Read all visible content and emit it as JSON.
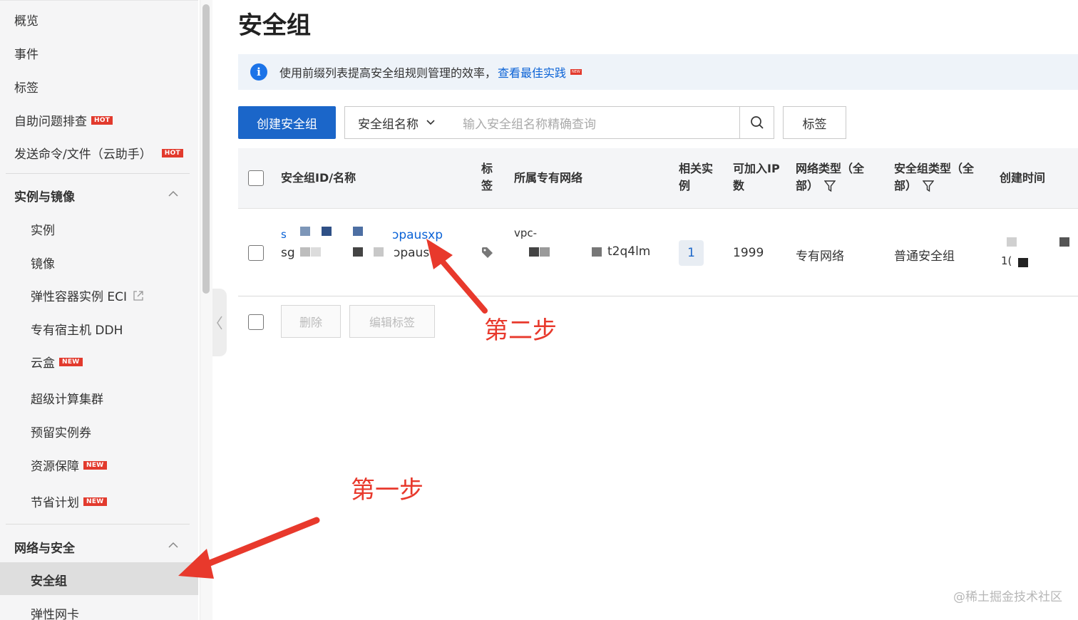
{
  "sidebar": {
    "top_items": [
      {
        "label": "概览"
      },
      {
        "label": "事件"
      },
      {
        "label": "标签"
      },
      {
        "label": "自助问题排查",
        "badge": "HOT"
      },
      {
        "label": "发送命令/文件（云助手）",
        "badge": "HOT"
      }
    ],
    "section_instances": {
      "title": "实例与镜像",
      "items": [
        {
          "label": "实例"
        },
        {
          "label": "镜像"
        },
        {
          "label": "弹性容器实例 ECI"
        },
        {
          "label": "专有宿主机 DDH"
        },
        {
          "label": "云盒",
          "badge": "NEW"
        },
        {
          "label": "超级计算集群"
        },
        {
          "label": "预留实例券"
        },
        {
          "label": "资源保障",
          "badge": "NEW"
        },
        {
          "label": "节省计划",
          "badge": "NEW"
        }
      ]
    },
    "section_network": {
      "title": "网络与安全",
      "items": [
        {
          "label": "安全组",
          "active": true
        },
        {
          "label": "弹性网卡"
        }
      ]
    }
  },
  "main": {
    "title": "安全组",
    "info": {
      "text": "使用前缀列表提高安全组规则管理的效率，",
      "link": "查看最佳实践",
      "link_badge": "NEW"
    },
    "toolbar": {
      "create_label": "创建安全组",
      "filter_field": "安全组名称",
      "search_placeholder": "输入安全组名称精确查询",
      "tag_label": "标签"
    },
    "table": {
      "headers": {
        "id_name": "安全组ID/名称",
        "tag_line1": "标",
        "tag_line2": "签",
        "vpc": "所属专有网络",
        "instances_line1": "相关实",
        "instances_line2": "例",
        "ip_line1": "可加入IP",
        "ip_line2": "数",
        "nettype_line1": "网络类型（全",
        "nettype_line2": "部）",
        "sgtype_line1": "安全组类型（全",
        "sgtype_line2": "部）",
        "created": "创建时间"
      },
      "row": {
        "id_prefix": "s",
        "id_suffix": "ɔpausxp",
        "name_prefix": "sg",
        "name_suffix": "ɔpaus",
        "vpc_line1": "vpc-",
        "vpc_suffix": "t2q4lm",
        "instances": "1",
        "ip_count": "1999",
        "network_type": "专有网络",
        "sg_type": "普通安全组",
        "created_fragment": "1("
      },
      "footer": {
        "delete_label": "删除",
        "edit_tags_label": "编辑标签"
      }
    }
  },
  "annotations": {
    "step1": "第一步",
    "step2": "第二步"
  },
  "watermark": "@稀土掘金技术社区",
  "colors": {
    "primary": "#1b66c9",
    "link": "#0a62d6",
    "badge": "#e23a2d",
    "annotation": "#e8392c"
  }
}
